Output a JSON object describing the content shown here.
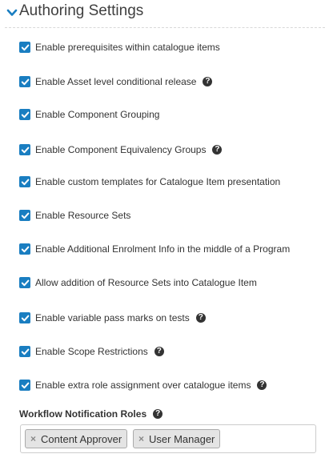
{
  "header": {
    "title": "Authoring Settings"
  },
  "options": [
    {
      "label": "Enable prerequisites within catalogue items",
      "checked": true,
      "help": false
    },
    {
      "label": "Enable Asset level conditional release",
      "checked": true,
      "help": true
    },
    {
      "label": "Enable Component Grouping",
      "checked": true,
      "help": false
    },
    {
      "label": "Enable Component Equivalency Groups",
      "checked": true,
      "help": true
    },
    {
      "label": "Enable custom templates for Catalogue Item presentation",
      "checked": true,
      "help": false
    },
    {
      "label": "Enable Resource Sets",
      "checked": true,
      "help": false
    },
    {
      "label": "Enable Additional Enrolment Info in the middle of a Program",
      "checked": true,
      "help": false
    },
    {
      "label": "Allow addition of Resource Sets into Catalogue Item",
      "checked": true,
      "help": false
    },
    {
      "label": "Enable variable pass marks on tests",
      "checked": true,
      "help": true
    },
    {
      "label": "Enable Scope Restrictions",
      "checked": true,
      "help": true
    },
    {
      "label": "Enable extra role assignment over catalogue items",
      "checked": true,
      "help": true
    }
  ],
  "workflow": {
    "label": "Workflow Notification Roles",
    "remove_glyph": "×",
    "help_glyph": "?",
    "tags": [
      "Content Approver",
      "User Manager"
    ]
  },
  "icons": {
    "chevron": "chevron-down-icon",
    "checkbox": "checkmark-icon",
    "help": "question-circle-icon"
  },
  "colors": {
    "accent": "#1a7ec1",
    "text": "#333333",
    "tag_bg": "#e4e4e4"
  }
}
